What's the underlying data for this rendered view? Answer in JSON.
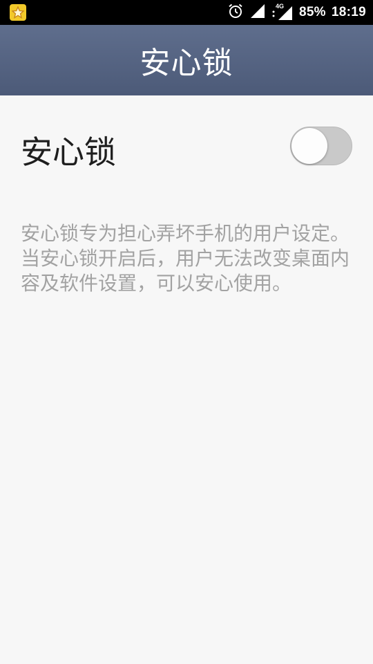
{
  "status_bar": {
    "app_badge_icon": "star-badge-icon",
    "alarm_icon": "alarm-icon",
    "signal_icon": "signal-icon",
    "network_type": "4G",
    "battery_percent": "85%",
    "time": "18:19"
  },
  "header": {
    "title": "安心锁"
  },
  "setting": {
    "label": "安心锁",
    "enabled": false
  },
  "description": "安心锁专为担心弄坏手机的用户设定。当安心锁开启后，用户无法改变桌面内容及软件设置，可以安心使用。",
  "colors": {
    "header_bg": "#56647f",
    "status_bar_bg": "#000000",
    "page_bg": "#f7f7f7",
    "toggle_off_track": "#c9c9c9",
    "description_text": "#a2a2a2"
  }
}
